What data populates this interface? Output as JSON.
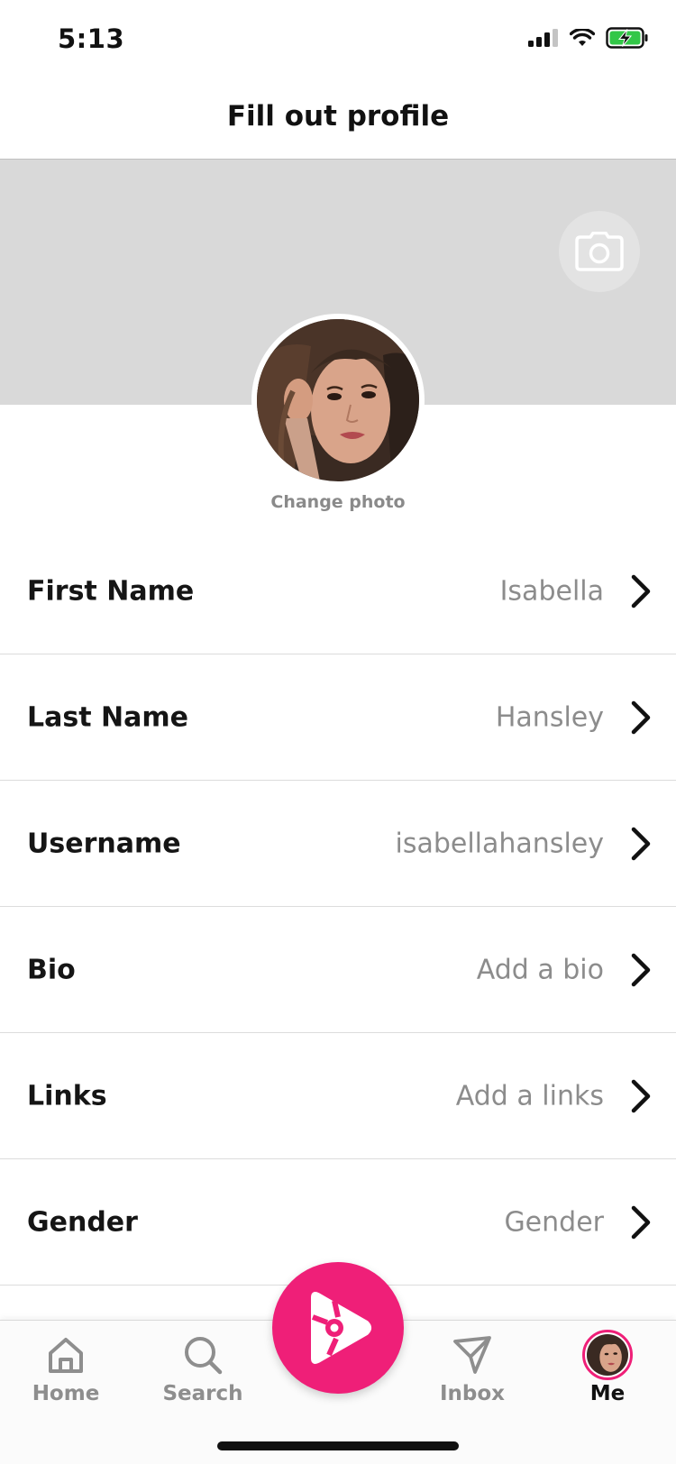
{
  "status_bar": {
    "time": "5:13",
    "icons": [
      "signal-icon",
      "wifi-icon",
      "battery-charging-icon"
    ],
    "battery_color": "#33c748"
  },
  "header": {
    "title": "Fill out profile"
  },
  "cover": {
    "background": "#d9d9d9",
    "camera_icon": "camera-icon"
  },
  "avatar": {
    "change_photo_label": "Change photo"
  },
  "fields": [
    {
      "label": "First Name",
      "value": "Isabella"
    },
    {
      "label": "Last Name",
      "value": "Hansley"
    },
    {
      "label": "Username",
      "value": "isabellahansley"
    },
    {
      "label": "Bio",
      "value": "Add a bio"
    },
    {
      "label": "Links",
      "value": "Add a links"
    },
    {
      "label": "Gender",
      "value": "Gender"
    }
  ],
  "tabbar": {
    "accent": "#ef1f78",
    "tabs": [
      {
        "label": "Home",
        "icon": "home-icon"
      },
      {
        "label": "Search",
        "icon": "search-icon"
      },
      {
        "label": "Inbox",
        "icon": "send-icon"
      },
      {
        "label": "Me",
        "icon": "avatar",
        "active": true
      }
    ],
    "center_button_icon": "create-play-icon"
  }
}
